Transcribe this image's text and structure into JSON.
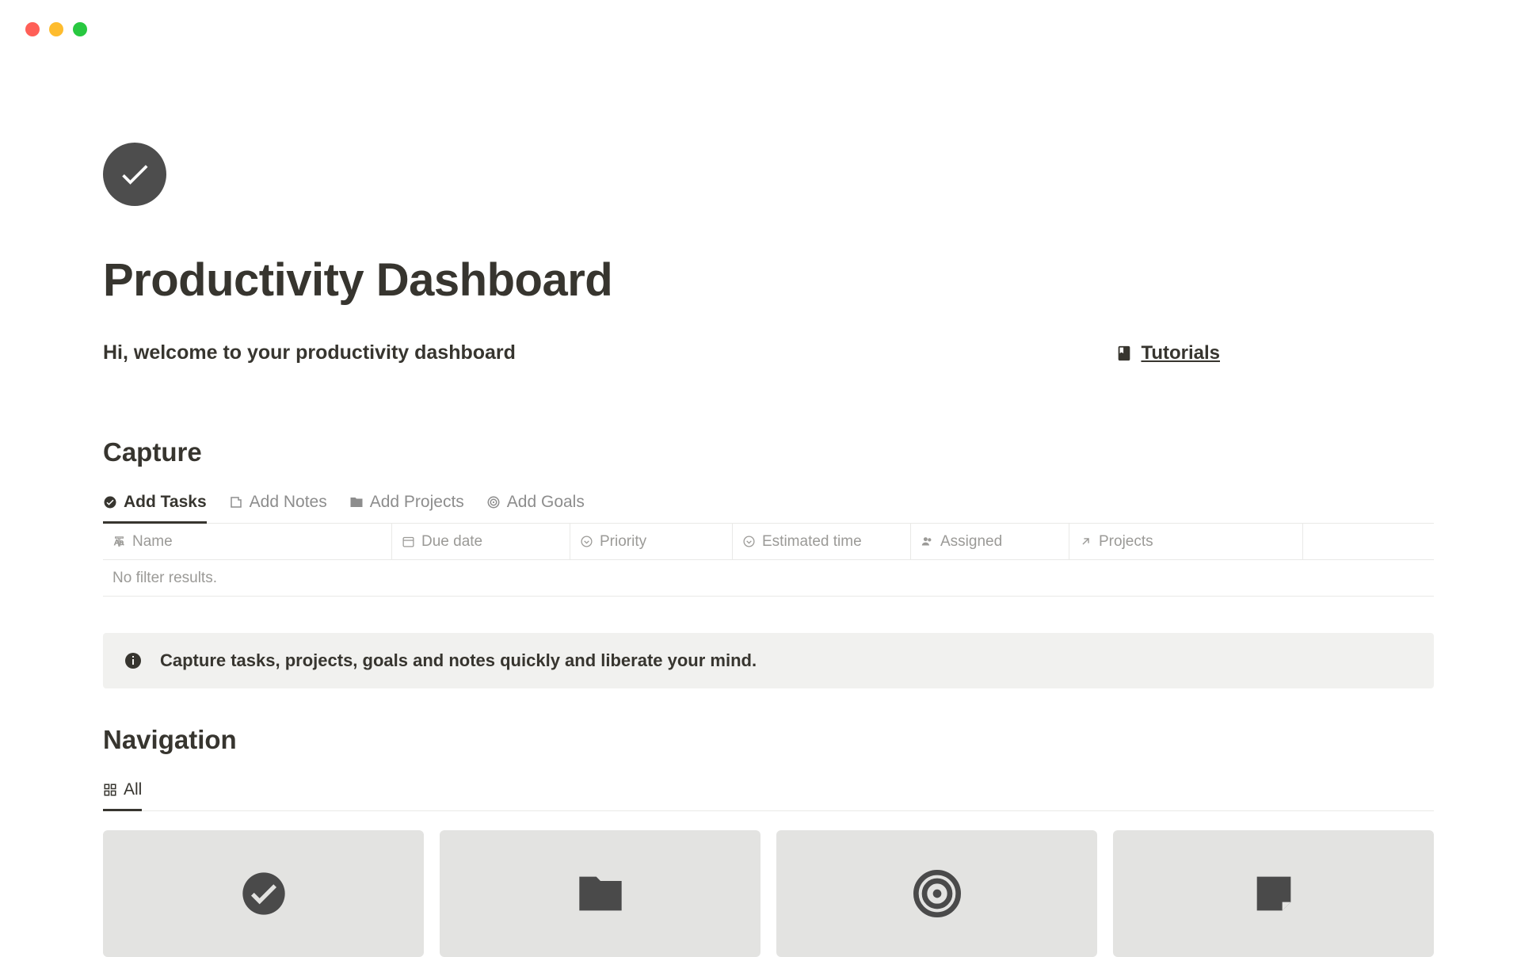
{
  "page": {
    "title": "Productivity Dashboard",
    "welcome": "Hi, welcome to your productivity dashboard",
    "tutorials_label": "Tutorials"
  },
  "capture": {
    "heading": "Capture",
    "tabs": [
      {
        "label": "Add Tasks"
      },
      {
        "label": "Add Notes"
      },
      {
        "label": "Add Projects"
      },
      {
        "label": "Add Goals"
      }
    ],
    "columns": {
      "name": "Name",
      "due_date": "Due date",
      "priority": "Priority",
      "estimated_time": "Estimated time",
      "assigned": "Assigned",
      "projects": "Projects"
    },
    "empty_message": "No filter results.",
    "callout_text": "Capture tasks, projects, goals and notes quickly and liberate your mind."
  },
  "navigation": {
    "heading": "Navigation",
    "tab_label": "All",
    "cards": [
      {
        "icon": "check-circle-icon"
      },
      {
        "icon": "folder-icon"
      },
      {
        "icon": "target-icon"
      },
      {
        "icon": "sticky-note-icon"
      }
    ]
  }
}
